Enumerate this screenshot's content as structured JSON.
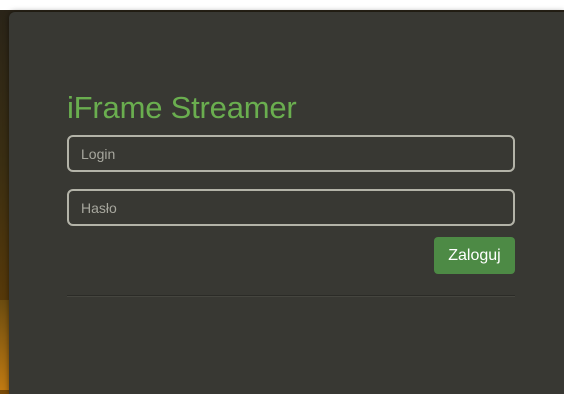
{
  "app": {
    "title": "iFrame Streamer"
  },
  "form": {
    "login_placeholder": "Login",
    "password_placeholder": "Hasło",
    "submit_label": "Zaloguj"
  },
  "colors": {
    "modal_background": "#383833",
    "title_green": "#6aae4f",
    "button_green": "#4d8a45",
    "field_border": "#b3b3a8"
  }
}
